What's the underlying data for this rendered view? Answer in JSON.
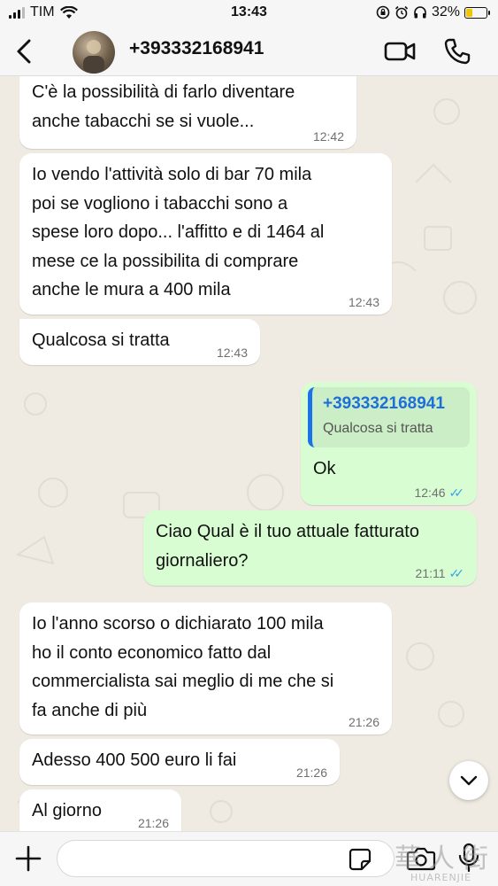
{
  "status_bar": {
    "carrier": "TIM",
    "time": "13:43",
    "battery": "32%",
    "battery_level": 0.32
  },
  "header": {
    "contact": "+393332168941"
  },
  "messages": [
    {
      "dir": "in",
      "text": "C'è la possibilità di farlo diventare\nanche tabacchi se si vuole...",
      "time": "12:42"
    },
    {
      "dir": "in",
      "text": "Io vendo l'attività solo di bar 70 mila\npoi se vogliono i tabacchi sono a\nspese loro dopo... l'affitto e di 1464 al\nmese ce la possibilita di comprare\nanche le mura a 400 mila",
      "time": "12:43"
    },
    {
      "dir": "in",
      "text": "Qualcosa si tratta",
      "time": "12:43"
    },
    {
      "dir": "out",
      "quote_author": "+393332168941",
      "quote_text": "Qualcosa si tratta",
      "text": "Ok",
      "time": "12:46"
    },
    {
      "dir": "out",
      "text": "Ciao Qual è il tuo attuale fatturato\ngiornaliero?",
      "time": "21:11"
    },
    {
      "dir": "in",
      "text": "Io l'anno scorso o dichiarato 100 mila\nho il conto economico fatto dal\ncommercialista sai meglio di me che si\nfa anche di più",
      "time": "21:26"
    },
    {
      "dir": "in",
      "text": "Adesso 400 500 euro li fai",
      "time": "21:26"
    },
    {
      "dir": "in",
      "text": "Al giorno",
      "time": "21:26"
    }
  ],
  "watermark": {
    "cn": "華人街",
    "en": "HUARENJIE"
  },
  "colors": {
    "chat_bg": "#efeae2",
    "incoming": "#ffffff",
    "outgoing": "#d9fdd3",
    "read_ticks": "#34a4e6",
    "quote_bar": "#1a73e8"
  }
}
